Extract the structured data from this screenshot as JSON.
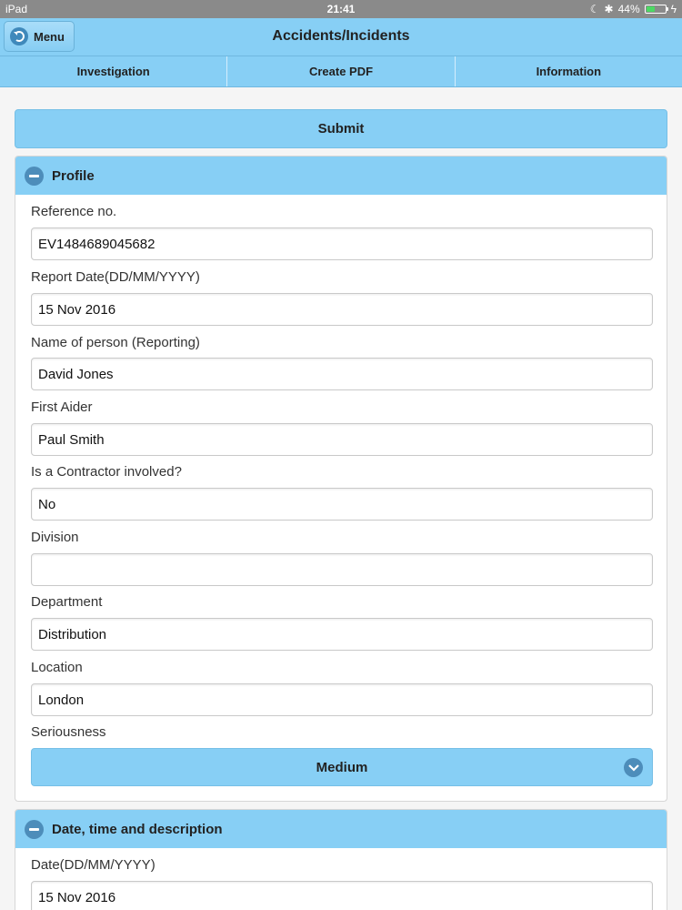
{
  "status_bar": {
    "device": "iPad",
    "time": "21:41",
    "battery": "44%"
  },
  "header": {
    "menu_label": "Menu",
    "title": "Accidents/Incidents"
  },
  "tabs": [
    {
      "label": "Investigation"
    },
    {
      "label": "Create PDF"
    },
    {
      "label": "Information"
    }
  ],
  "submit_label": "Submit",
  "profile": {
    "title": "Profile",
    "fields": [
      {
        "label": "Reference no.",
        "value": "EV1484689045682"
      },
      {
        "label": "Report Date(DD/MM/YYYY)",
        "value": "15 Nov 2016"
      },
      {
        "label": "Name of person (Reporting)",
        "value": "David Jones"
      },
      {
        "label": "First Aider",
        "value": "Paul Smith"
      },
      {
        "label": "Is a Contractor involved?",
        "value": "No"
      },
      {
        "label": "Division",
        "value": ""
      },
      {
        "label": "Department",
        "value": "Distribution"
      },
      {
        "label": "Location",
        "value": "London"
      }
    ],
    "seriousness": {
      "label": "Seriousness",
      "value": "Medium"
    }
  },
  "date_section": {
    "title": "Date, time and description",
    "fields": [
      {
        "label": "Date(DD/MM/YYYY)",
        "value": "15 Nov 2016"
      }
    ]
  },
  "colors": {
    "accent": "#87cff5",
    "icon": "#4d8dba"
  }
}
